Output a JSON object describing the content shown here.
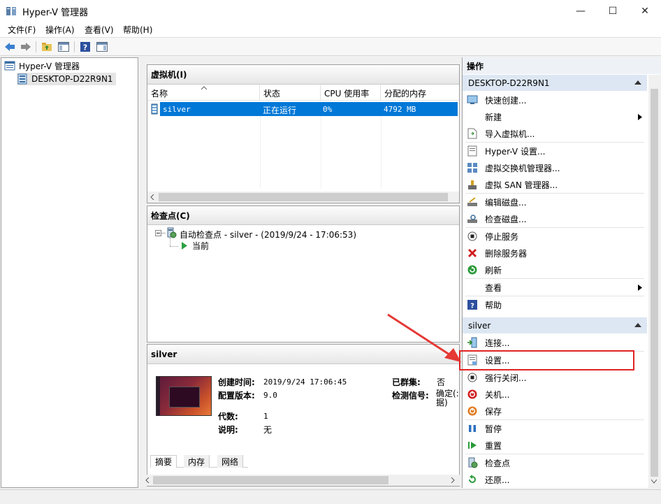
{
  "window": {
    "title": "Hyper-V 管理器",
    "min": "—",
    "max": "☐",
    "close": "✕"
  },
  "menu": [
    "文件(F)",
    "操作(A)",
    "查看(V)",
    "帮助(H)"
  ],
  "tree": {
    "root": "Hyper-V 管理器",
    "server": "DESKTOP-D22R9N1"
  },
  "vm_panel": {
    "title": "虚拟机(I)",
    "columns": [
      "名称",
      "状态",
      "CPU 使用率",
      "分配的内存"
    ],
    "rows": [
      {
        "name": "silver",
        "state": "正在运行",
        "cpu": "0%",
        "memory": "4792 MB"
      }
    ]
  },
  "checkpoint_panel": {
    "title": "检查点(C)",
    "items": [
      "自动检查点 - silver - (2019/9/24 - 17:06:53)",
      "当前"
    ]
  },
  "detail_panel": {
    "title": "silver",
    "created_label": "创建时间:",
    "created_value": "2019/9/24 17:06:45",
    "config_label": "配置版本:",
    "config_value": "9.0",
    "gen_label": "代数:",
    "gen_value": "1",
    "notes_label": "说明:",
    "notes_value": "无",
    "clustered_label": "已群集:",
    "clustered_value": "否",
    "heartbeat_label": "检测信号:",
    "heartbeat_value": "确定(无应用程序数据)",
    "heartbeat_line1": "确定(:",
    "heartbeat_line2": "据)",
    "tabs": [
      "摘要",
      "内存",
      "网络"
    ]
  },
  "actions": {
    "title": "操作",
    "server_group": "DESKTOP-D22R9N1",
    "server_items": [
      "快速创建...",
      "新建",
      "导入虚拟机...",
      "Hyper-V 设置...",
      "虚拟交换机管理器...",
      "虚拟 SAN 管理器...",
      "编辑磁盘...",
      "检查磁盘...",
      "停止服务",
      "删除服务器",
      "刷新",
      "查看",
      "帮助"
    ],
    "vm_group": "silver",
    "vm_items": [
      "连接...",
      "设置...",
      "强行关闭...",
      "关机...",
      "保存",
      "暂停",
      "重置",
      "检查点",
      "还原..."
    ]
  },
  "colors": {
    "selection": "#0078d7",
    "highlight_box": "#e02424",
    "arrow": "#e53935"
  }
}
